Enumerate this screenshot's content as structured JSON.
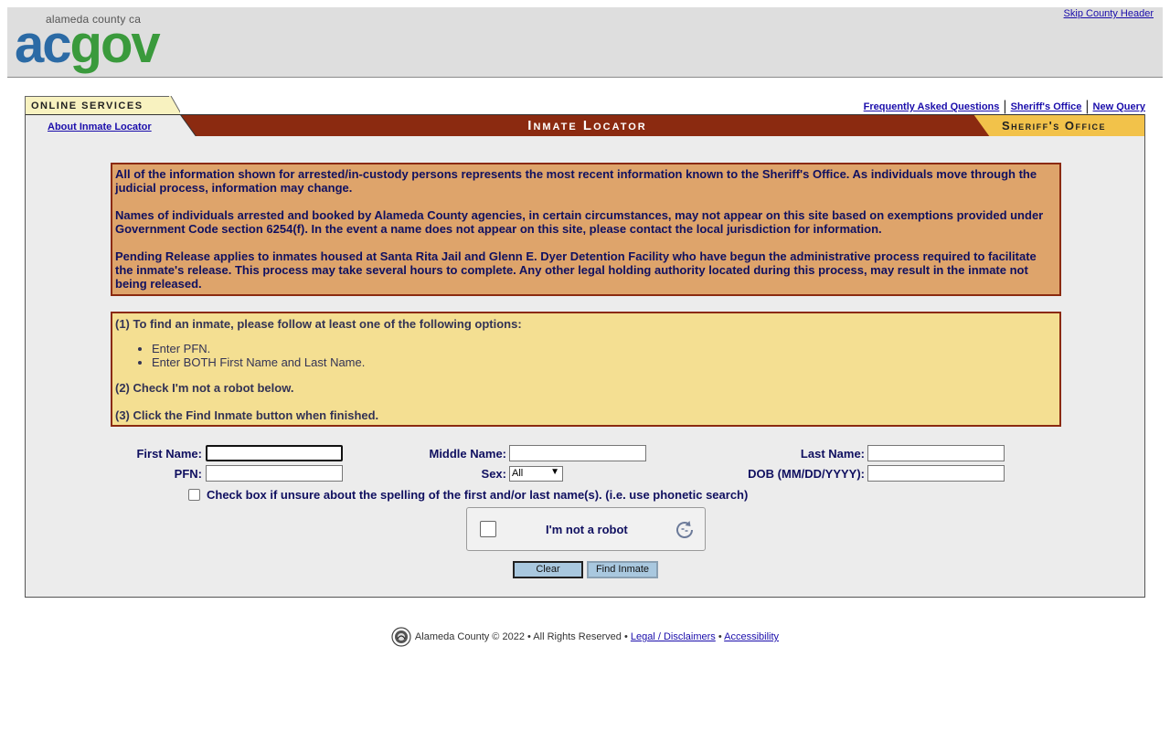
{
  "county_header": {
    "logo_tagline": "alameda county ca",
    "logo_part1": "ac",
    "logo_part2": "gov",
    "skip_link": "Skip County Header"
  },
  "service_bar": {
    "online_services": "ONLINE SERVICES",
    "about_link": "About Inmate Locator",
    "title": "Inmate Locator",
    "sheriff_label": "Sheriff's Office",
    "links": [
      "Frequently Asked Questions",
      "Sheriff's Office",
      "New Query"
    ]
  },
  "notice": {
    "paragraphs": [
      "All of the information shown for arrested/in-custody persons represents the most recent information known to the Sheriff's Office.  As individuals move through the judicial process, information may change.",
      "Names of individuals arrested and booked by Alameda County agencies, in certain circumstances, may not appear on this site based on exemptions provided under Government Code section 6254(f).  In the event a name does not appear on this site, please contact the local jurisdiction for information.",
      "Pending Release applies to inmates housed at Santa Rita Jail and Glenn E. Dyer Detention Facility who have begun the administrative process required to facilitate the inmate's release.  This process may take several hours to complete.  Any other legal holding authority located during this process, may result in the inmate not being released."
    ]
  },
  "instructions": {
    "step1": "(1) To find an inmate, please follow at least one of the following options:",
    "options": [
      "Enter PFN.",
      "Enter BOTH First Name and Last Name."
    ],
    "step2": "(2) Check I'm not a robot below.",
    "step3": "(3) Click the Find Inmate button when finished."
  },
  "form": {
    "first_name_label": "First Name:",
    "first_name_value": "",
    "middle_name_label": "Middle Name:",
    "middle_name_value": "",
    "last_name_label": "Last Name:",
    "last_name_value": "",
    "pfn_label": "PFN:",
    "pfn_value": "",
    "sex_label": "Sex:",
    "sex_value": "All",
    "dob_label": "DOB (MM/DD/YYYY):",
    "dob_value": "",
    "phonetic_label": "Check box if unsure about the spelling of the first and/or last name(s). (i.e. use phonetic search)",
    "phonetic_checked": false,
    "captcha_label": "I'm not a robot",
    "clear_button": "Clear",
    "find_button": "Find Inmate"
  },
  "footer": {
    "copyright": "Alameda County © 2022 • All Rights Reserved •",
    "legal_link": "Legal / Disclaimers",
    "separator": "•",
    "accessibility_link": "Accessibility"
  },
  "colors": {
    "header_bg": "#dedede",
    "title_bar": "#8b2a10",
    "sheriff_tab": "#f2c24a",
    "notice_bg": "#dea46b",
    "instructions_bg": "#f4df92",
    "panel_bg": "#ececec",
    "label_text": "#101060"
  }
}
